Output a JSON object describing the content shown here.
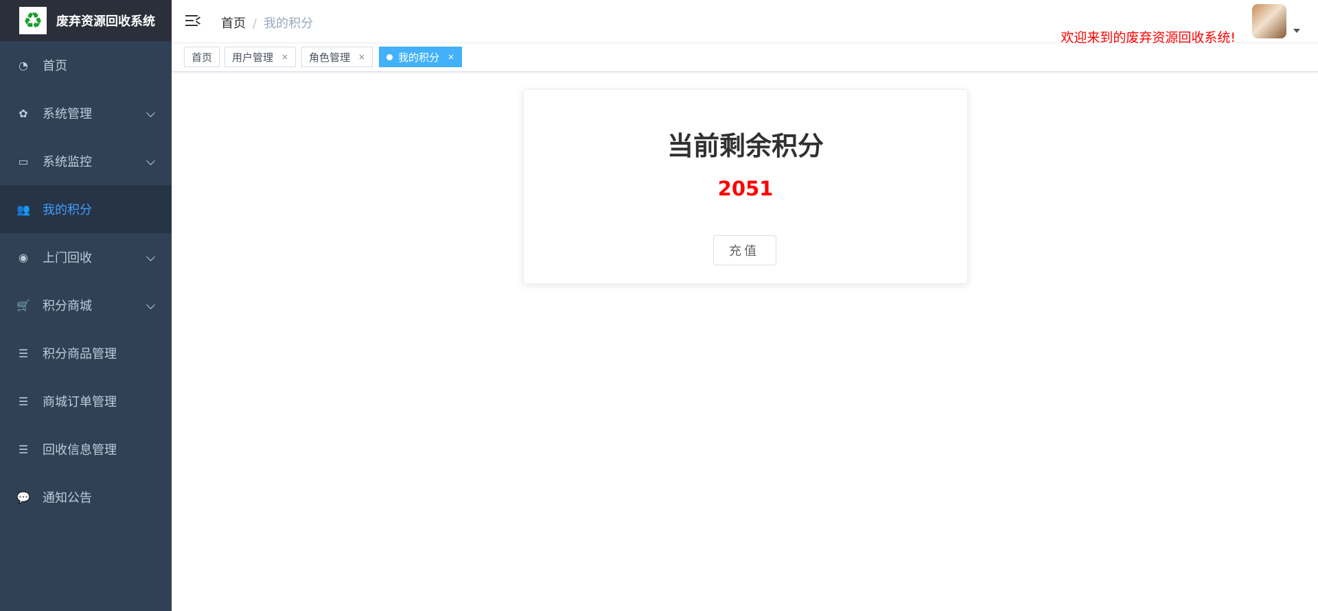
{
  "app": {
    "title": "废弃资源回收系统",
    "logo_icon": "recycle-icon",
    "logo_glyph": "♻"
  },
  "sidebar": {
    "items": [
      {
        "label": "首页",
        "icon": "dashboard-icon",
        "glyph": "◔",
        "has_arrow": false,
        "active": false
      },
      {
        "label": "系统管理",
        "icon": "gear-icon",
        "glyph": "✿",
        "has_arrow": true,
        "active": false
      },
      {
        "label": "系统监控",
        "icon": "monitor-icon",
        "glyph": "▭",
        "has_arrow": true,
        "active": false
      },
      {
        "label": "我的积分",
        "icon": "user-icon",
        "glyph": "👥",
        "has_arrow": false,
        "active": true
      },
      {
        "label": "上门回收",
        "icon": "lifebuoy-icon",
        "glyph": "◉",
        "has_arrow": true,
        "active": false
      },
      {
        "label": "积分商城",
        "icon": "cart-icon",
        "glyph": "🛒",
        "has_arrow": true,
        "active": false
      },
      {
        "label": "积分商品管理",
        "icon": "list-icon",
        "glyph": "☰",
        "has_arrow": false,
        "active": false
      },
      {
        "label": "商城订单管理",
        "icon": "list-icon",
        "glyph": "☰",
        "has_arrow": false,
        "active": false
      },
      {
        "label": "回收信息管理",
        "icon": "list-icon",
        "glyph": "☰",
        "has_arrow": false,
        "active": false
      },
      {
        "label": "通知公告",
        "icon": "message-icon",
        "glyph": "💬",
        "has_arrow": false,
        "active": false
      }
    ]
  },
  "navbar": {
    "breadcrumb": {
      "home": "首页",
      "separator": "/",
      "current": "我的积分"
    },
    "welcome": "欢迎来到的废弃资源回收系统!"
  },
  "tags": [
    {
      "label": "首页",
      "closable": false,
      "active": false
    },
    {
      "label": "用户管理",
      "closable": true,
      "active": false
    },
    {
      "label": "角色管理",
      "closable": true,
      "active": false
    },
    {
      "label": "我的积分",
      "closable": true,
      "active": true
    }
  ],
  "tag_close_glyph": "×",
  "card": {
    "title": "当前剩余积分",
    "points": "2051",
    "recharge_label": "充值"
  },
  "colors": {
    "sidebar_bg": "#304156",
    "sidebar_active_bg": "#263445",
    "accent": "#409eff",
    "tag_active": "#42b1f9",
    "points": "#ff0000"
  }
}
